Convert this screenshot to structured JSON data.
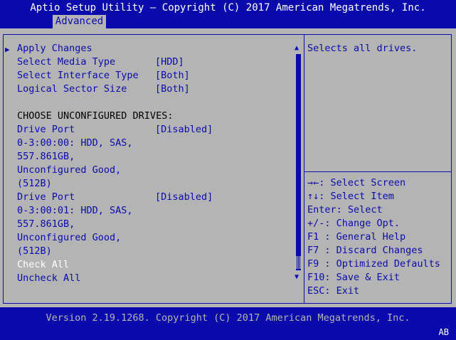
{
  "header": {
    "title": "Aptio Setup Utility – Copyright (C) 2017 American Megatrends, Inc.",
    "active_tab": "Advanced"
  },
  "menu": {
    "apply_changes": "Apply Changes",
    "options": [
      {
        "label": "Select Media Type",
        "value": "[HDD]"
      },
      {
        "label": "Select Interface Type",
        "value": "[Both]"
      },
      {
        "label": "Logical Sector Size",
        "value": "[Both]"
      }
    ],
    "section_heading": "CHOOSE UNCONFIGURED DRIVES:",
    "drives": [
      {
        "label": "Drive Port",
        "value": "[Disabled]",
        "info": [
          "0-3:00:00: HDD, SAS,",
          "557.861GB,",
          "Unconfigured Good,",
          "(512B)"
        ]
      },
      {
        "label": "Drive Port",
        "value": "[Disabled]",
        "info": [
          "0-3:00:01: HDD, SAS,",
          "557.861GB,",
          "Unconfigured Good,",
          "(512B)"
        ]
      }
    ],
    "check_all": "Check All",
    "uncheck_all": "Uncheck All",
    "scrollbar": {
      "up_icon": "▲",
      "down_icon": "▼"
    }
  },
  "help": {
    "description": "Selects all drives.",
    "keys": [
      "→←: Select Screen",
      "↑↓: Select Item",
      "Enter: Select",
      "+/-: Change Opt.",
      "F1 : General Help",
      "F7 : Discard Changes",
      "F9 : Optimized Defaults",
      "F10: Save & Exit",
      "ESC: Exit"
    ]
  },
  "footer": {
    "version": "Version 2.19.1268. Copyright (C) 2017 American Megatrends, Inc.",
    "badge": "AB"
  },
  "colors": {
    "background": "#0b0bac",
    "panel": "#b4b4b4",
    "text": "#0b0bac",
    "selected": "#ffffff"
  }
}
